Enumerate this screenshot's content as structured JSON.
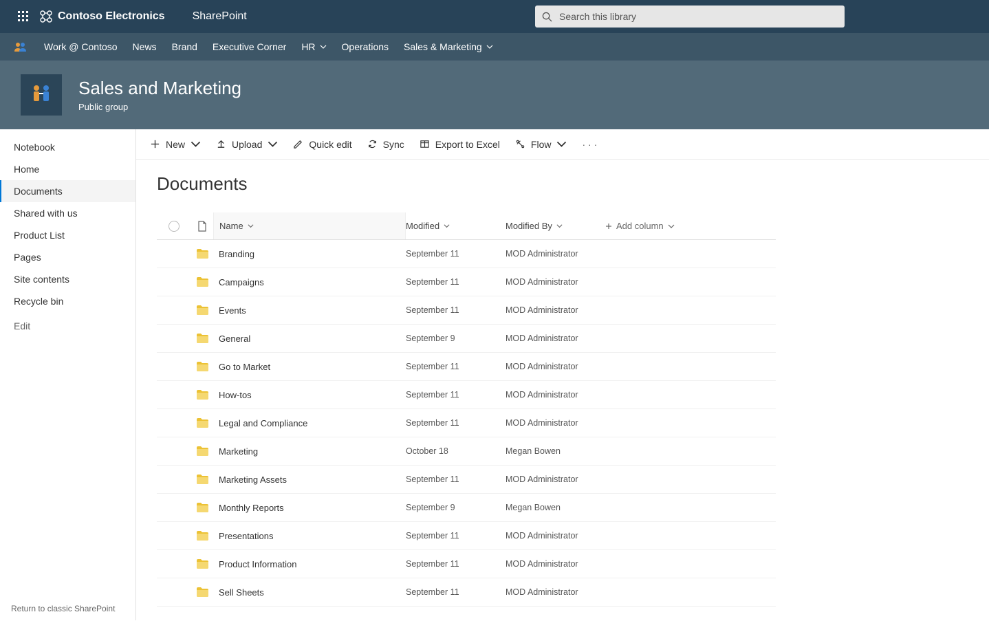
{
  "suite": {
    "brand": "Contoso Electronics",
    "app": "SharePoint",
    "search_placeholder": "Search this library"
  },
  "hubnav": {
    "items": [
      {
        "label": "Work @ Contoso",
        "chev": false
      },
      {
        "label": "News",
        "chev": false
      },
      {
        "label": "Brand",
        "chev": false
      },
      {
        "label": "Executive Corner",
        "chev": false
      },
      {
        "label": "HR",
        "chev": true
      },
      {
        "label": "Operations",
        "chev": false
      },
      {
        "label": "Sales & Marketing",
        "chev": true
      }
    ]
  },
  "site": {
    "title": "Sales and Marketing",
    "subtitle": "Public group"
  },
  "leftnav": {
    "items": [
      {
        "label": "Notebook"
      },
      {
        "label": "Home"
      },
      {
        "label": "Documents",
        "active": true
      },
      {
        "label": "Shared with us"
      },
      {
        "label": "Product List"
      },
      {
        "label": "Pages"
      },
      {
        "label": "Site contents"
      },
      {
        "label": "Recycle bin"
      }
    ],
    "edit_label": "Edit",
    "return_label": "Return to classic SharePoint"
  },
  "commands": {
    "new": "New",
    "upload": "Upload",
    "quickedit": "Quick edit",
    "sync": "Sync",
    "export": "Export to Excel",
    "flow": "Flow"
  },
  "listing": {
    "page_title": "Documents",
    "columns": {
      "name": "Name",
      "modified": "Modified",
      "modified_by": "Modified By",
      "add": "Add column"
    },
    "rows": [
      {
        "name": "Branding",
        "modified": "September 11",
        "modified_by": "MOD Administrator"
      },
      {
        "name": "Campaigns",
        "modified": "September 11",
        "modified_by": "MOD Administrator"
      },
      {
        "name": "Events",
        "modified": "September 11",
        "modified_by": "MOD Administrator"
      },
      {
        "name": "General",
        "modified": "September 9",
        "modified_by": "MOD Administrator"
      },
      {
        "name": "Go to Market",
        "modified": "September 11",
        "modified_by": "MOD Administrator"
      },
      {
        "name": "How-tos",
        "modified": "September 11",
        "modified_by": "MOD Administrator"
      },
      {
        "name": "Legal and Compliance",
        "modified": "September 11",
        "modified_by": "MOD Administrator"
      },
      {
        "name": "Marketing",
        "modified": "October 18",
        "modified_by": "Megan Bowen"
      },
      {
        "name": "Marketing Assets",
        "modified": "September 11",
        "modified_by": "MOD Administrator"
      },
      {
        "name": "Monthly Reports",
        "modified": "September 9",
        "modified_by": "Megan Bowen"
      },
      {
        "name": "Presentations",
        "modified": "September 11",
        "modified_by": "MOD Administrator"
      },
      {
        "name": "Product Information",
        "modified": "September 11",
        "modified_by": "MOD Administrator"
      },
      {
        "name": "Sell Sheets",
        "modified": "September 11",
        "modified_by": "MOD Administrator"
      }
    ]
  }
}
